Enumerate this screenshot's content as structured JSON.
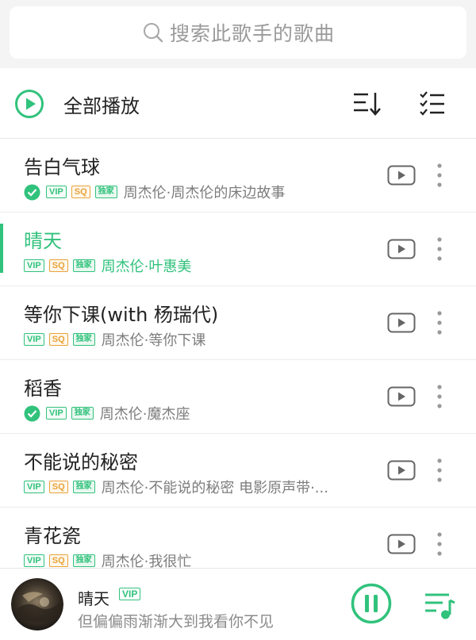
{
  "search": {
    "placeholder": "搜索此歌手的歌曲"
  },
  "toolbar": {
    "play_all_label": "全部播放"
  },
  "songs": [
    {
      "title": "告白气球",
      "artist": "周杰伦·周杰伦的床边故事",
      "badges": [
        "VIP",
        "SQ",
        "独家"
      ],
      "downloaded": true,
      "active": false
    },
    {
      "title": "晴天",
      "artist": "周杰伦·叶惠美",
      "badges": [
        "VIP",
        "SQ",
        "独家"
      ],
      "downloaded": false,
      "active": true
    },
    {
      "title": "等你下课(with 杨瑞代)",
      "artist": "周杰伦·等你下课",
      "badges": [
        "VIP",
        "SQ",
        "独家"
      ],
      "downloaded": false,
      "active": false
    },
    {
      "title": "稻香",
      "artist": "周杰伦·魔杰座",
      "badges": [
        "VIP",
        "独家"
      ],
      "downloaded": true,
      "active": false
    },
    {
      "title": "不能说的秘密",
      "artist": "周杰伦·不能说的秘密 电影原声带·...",
      "badges": [
        "VIP",
        "SQ",
        "独家"
      ],
      "downloaded": false,
      "active": false
    },
    {
      "title": "青花瓷",
      "artist": "周杰伦·我很忙",
      "badges": [
        "VIP",
        "SQ",
        "独家"
      ],
      "downloaded": false,
      "active": false
    }
  ],
  "player": {
    "title": "晴天",
    "badge": "VIP",
    "lyric": "但偏偏雨渐渐大到我看你不见"
  },
  "colors": {
    "accent": "#31c27c",
    "sq": "#e8a23a",
    "text_secondary": "#7d7d7d"
  },
  "icons": {
    "search": "search-icon",
    "play_all": "play-circle-icon",
    "sort": "sort-icon",
    "multiselect": "multiselect-list-icon",
    "mv": "video-play-icon",
    "more": "more-vertical-icon",
    "pause": "pause-circle-icon",
    "playlist": "playlist-icon",
    "downloaded": "check-circle-icon"
  }
}
